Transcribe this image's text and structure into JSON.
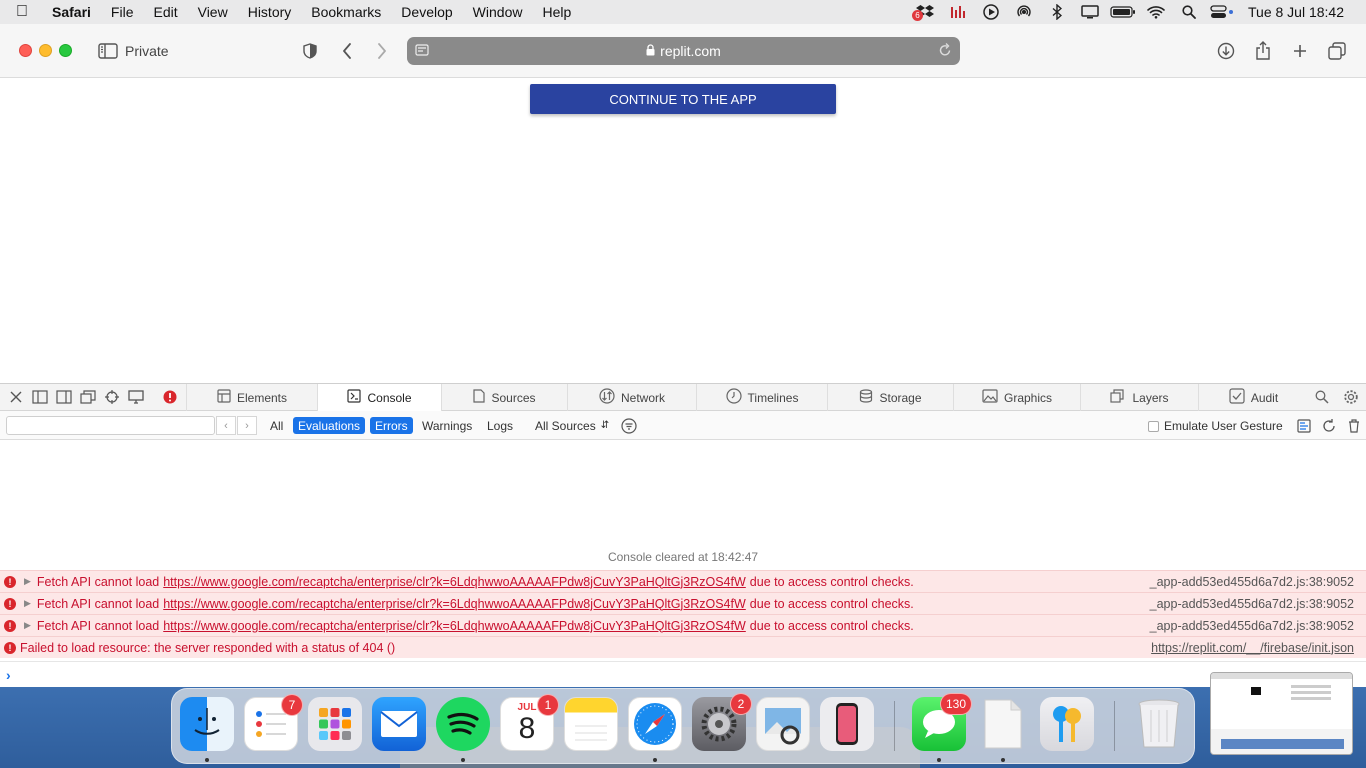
{
  "menubar": {
    "app_name": "Safari",
    "items": [
      "File",
      "Edit",
      "View",
      "History",
      "Bookmarks",
      "Develop",
      "Window",
      "Help"
    ],
    "status_icons": [
      "dropbox-icon",
      "istat-icon",
      "play-icon",
      "airdrop-icon",
      "bluetooth-icon",
      "display-icon",
      "battery-icon",
      "wifi-icon",
      "spotlight-search-icon",
      "control-center-icon"
    ],
    "dropbox_badge": "6",
    "clock": "Tue 8 Jul  18:42"
  },
  "toolbar": {
    "mode_label": "Private",
    "url": "replit.com"
  },
  "page": {
    "continue_button": "CONTINUE TO THE APP",
    "accent_color": "#2a43a0"
  },
  "devtools": {
    "tabs": [
      {
        "label": "Elements",
        "icon": "elements-icon"
      },
      {
        "label": "Console",
        "icon": "console-icon"
      },
      {
        "label": "Sources",
        "icon": "sources-icon"
      },
      {
        "label": "Network",
        "icon": "network-icon"
      },
      {
        "label": "Timelines",
        "icon": "timelines-icon"
      },
      {
        "label": "Storage",
        "icon": "storage-icon"
      },
      {
        "label": "Graphics",
        "icon": "graphics-icon"
      },
      {
        "label": "Layers",
        "icon": "layers-icon"
      },
      {
        "label": "Audit",
        "icon": "audit-icon"
      }
    ],
    "active_tab": "Console",
    "filters": {
      "all": "All",
      "evaluations": "Evaluations",
      "errors": "Errors",
      "warnings": "Warnings",
      "logs": "Logs",
      "sources": "All Sources"
    },
    "emulate_label": "Emulate User Gesture",
    "search_placeholder": "",
    "cleared_message": "Console cleared at 18:42:47",
    "errors": [
      {
        "prefix": "Fetch API cannot load",
        "url": "https://www.google.com/recaptcha/enterprise/clr?k=6LdqhwwoAAAAAFPdw8jCuvY3PaHQltGj3RzOS4fW",
        "suffix": "due to access control checks.",
        "source": "_app-add53ed455d6a7d2.js:38:9052"
      },
      {
        "prefix": "Fetch API cannot load",
        "url": "https://www.google.com/recaptcha/enterprise/clr?k=6LdqhwwoAAAAAFPdw8jCuvY3PaHQltGj3RzOS4fW",
        "suffix": "due to access control checks.",
        "source": "_app-add53ed455d6a7d2.js:38:9052"
      },
      {
        "prefix": "Fetch API cannot load",
        "url": "https://www.google.com/recaptcha/enterprise/clr?k=6LdqhwwoAAAAAFPdw8jCuvY3PaHQltGj3RzOS4fW",
        "suffix": "due to access control checks.",
        "source": "_app-add53ed455d6a7d2.js:38:9052"
      },
      {
        "message": "Failed to load resource: the server responded with a status of 404 ()",
        "source": "https://replit.com/__/firebase/init.json"
      }
    ]
  },
  "dock": {
    "apps": [
      {
        "name": "finder",
        "badge": ""
      },
      {
        "name": "reminders",
        "badge": "7"
      },
      {
        "name": "launchpad",
        "badge": ""
      },
      {
        "name": "mail",
        "badge": ""
      },
      {
        "name": "spotify",
        "badge": ""
      },
      {
        "name": "calendar",
        "badge": "1",
        "month": "JUL",
        "day": "8"
      },
      {
        "name": "notes",
        "badge": ""
      },
      {
        "name": "safari",
        "badge": ""
      },
      {
        "name": "system-settings",
        "badge": "2"
      },
      {
        "name": "preview",
        "badge": ""
      },
      {
        "name": "iphone-mirroring",
        "badge": ""
      },
      {
        "name": "messages",
        "badge": "130"
      },
      {
        "name": "document",
        "badge": ""
      },
      {
        "name": "passwords",
        "badge": ""
      },
      {
        "name": "trash",
        "badge": ""
      }
    ]
  }
}
